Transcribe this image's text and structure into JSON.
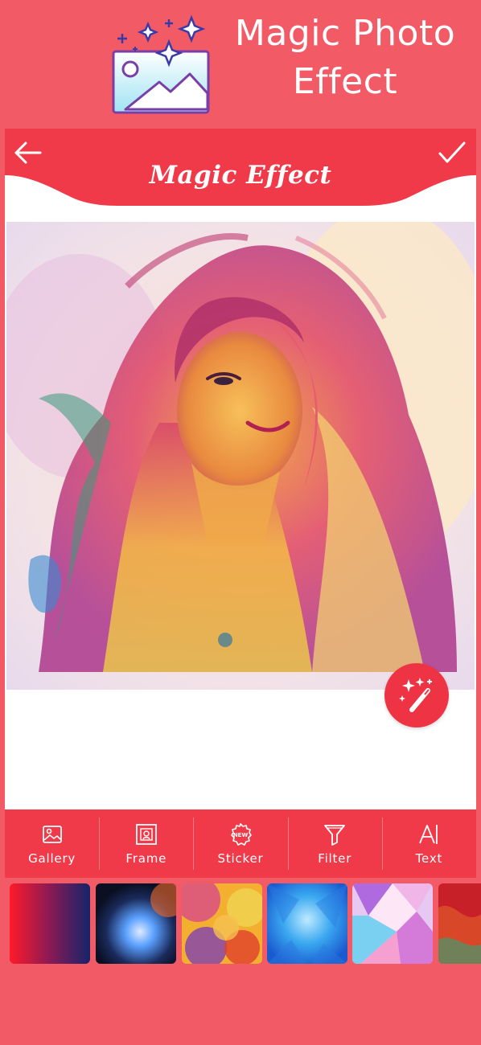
{
  "promo": {
    "title_line1": "Magic Photo",
    "title_line2": "Effect",
    "logo_icon": "image-sparkle-icon"
  },
  "app_bar": {
    "title": "Magic Effect",
    "back_icon": "arrow-left-icon",
    "done_icon": "checkmark-icon"
  },
  "magic_button_icon": "magic-wand-icon",
  "toolbar": {
    "items": [
      {
        "label": "Gallery",
        "icon": "image-icon"
      },
      {
        "label": "Frame",
        "icon": "frame-icon"
      },
      {
        "label": "Sticker",
        "icon": "new-badge-icon"
      },
      {
        "label": "Filter",
        "icon": "funnel-icon"
      },
      {
        "label": "Text",
        "icon": "text-icon"
      }
    ]
  },
  "backgrounds": [
    {
      "name": "red-navy-gradient"
    },
    {
      "name": "blue-light-flare"
    },
    {
      "name": "watercolor-multicolor"
    },
    {
      "name": "blue-polygon"
    },
    {
      "name": "pastel-polygon"
    },
    {
      "name": "red-foil"
    }
  ],
  "colors": {
    "background": "#f25a66",
    "accent": "#ee3444",
    "toolbar": "#f13a49",
    "canvas": "#ffffff"
  }
}
